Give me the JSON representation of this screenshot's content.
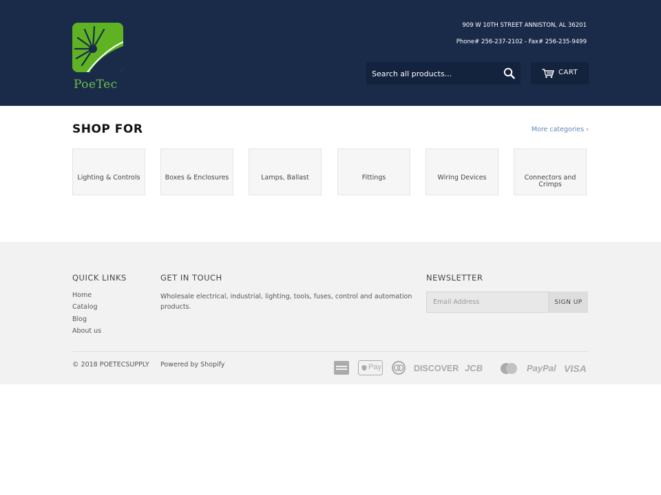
{
  "store": {
    "name": "PoeTec",
    "address": "909 W 10TH STREET ANNISTON, AL 36201",
    "phone": "Phone# 256-237-2102 - Fax# 256-235-9499"
  },
  "search": {
    "placeholder": "Search all products...",
    "icon": "search-icon"
  },
  "cart": {
    "label": "CART",
    "icon": "cart-icon"
  },
  "shop_for": {
    "title": "SHOP FOR",
    "more_link": "More categories ›",
    "categories": [
      {
        "label": "Lighting & Controls"
      },
      {
        "label": "Boxes & Enclosures"
      },
      {
        "label": "Lamps, Ballast"
      },
      {
        "label": "Fittings"
      },
      {
        "label": "Wiring Devices"
      },
      {
        "label": "Connectors and Crimps"
      }
    ]
  },
  "footer": {
    "quick_links": {
      "heading": "QUICK LINKS",
      "items": [
        {
          "label": "Home"
        },
        {
          "label": "Catalog"
        },
        {
          "label": "Blog"
        },
        {
          "label": "About us"
        }
      ]
    },
    "get_in_touch": {
      "heading": "GET IN TOUCH",
      "text": "Wholesale electrical, industrial, lighting, tools, fuses, control and automation products."
    },
    "newsletter": {
      "heading": "NEWSLETTER",
      "placeholder": "Email Address",
      "button": "SIGN UP"
    },
    "copyright": "© 2018 POETECSUPPLY",
    "powered_by": "Powered by Shopify",
    "payment_methods": [
      {
        "name": "american-express-icon"
      },
      {
        "name": "apple-pay-icon",
        "text": "Pay"
      },
      {
        "name": "diners-club-icon"
      },
      {
        "name": "discover-icon",
        "text": "DISCOVER"
      },
      {
        "name": "jcb-icon",
        "text": "JCB"
      },
      {
        "name": "mastercard-icon"
      },
      {
        "name": "paypal-icon",
        "text": "PayPal"
      },
      {
        "name": "visa-icon",
        "text": "VISA"
      }
    ]
  },
  "colors": {
    "header_bg": "#1a2b4a",
    "header_control_bg": "#13223d",
    "logo_green": "#5fb323",
    "link_blue": "#5c8ab8",
    "footer_bg": "#f2f2f2"
  }
}
